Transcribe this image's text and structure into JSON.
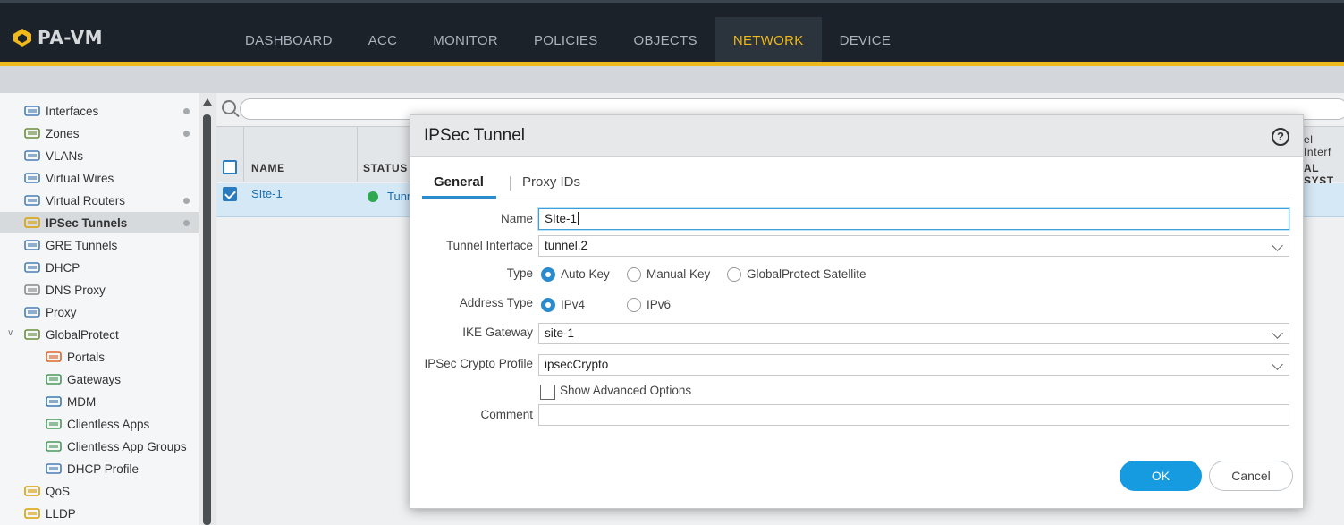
{
  "app": {
    "product": "PA-VM"
  },
  "nav": {
    "items": [
      "DASHBOARD",
      "ACC",
      "MONITOR",
      "POLICIES",
      "OBJECTS",
      "NETWORK",
      "DEVICE"
    ],
    "active": "NETWORK"
  },
  "sidebar": {
    "items": [
      {
        "label": "Interfaces",
        "icon": "interfaces-icon",
        "dot": true
      },
      {
        "label": "Zones",
        "icon": "zones-icon",
        "dot": true
      },
      {
        "label": "VLANs",
        "icon": "vlans-icon",
        "dot": false
      },
      {
        "label": "Virtual Wires",
        "icon": "virtual-wires-icon",
        "dot": false
      },
      {
        "label": "Virtual Routers",
        "icon": "virtual-routers-icon",
        "dot": true
      },
      {
        "label": "IPSec Tunnels",
        "icon": "ipsec-tunnels-icon",
        "dot": true,
        "selected": true
      },
      {
        "label": "GRE Tunnels",
        "icon": "gre-tunnels-icon",
        "dot": false
      },
      {
        "label": "DHCP",
        "icon": "dhcp-icon",
        "dot": false
      },
      {
        "label": "DNS Proxy",
        "icon": "dns-proxy-icon",
        "dot": false
      },
      {
        "label": "Proxy",
        "icon": "proxy-icon",
        "dot": false
      },
      {
        "label": "GlobalProtect",
        "icon": "globalprotect-icon",
        "dot": false,
        "expanded": true
      },
      {
        "label": "Portals",
        "icon": "portals-icon",
        "dot": false,
        "child": true
      },
      {
        "label": "Gateways",
        "icon": "gateways-icon",
        "dot": false,
        "child": true
      },
      {
        "label": "MDM",
        "icon": "mdm-icon",
        "dot": false,
        "child": true
      },
      {
        "label": "Clientless Apps",
        "icon": "clientless-apps-icon",
        "dot": false,
        "child": true
      },
      {
        "label": "Clientless App Groups",
        "icon": "clientless-app-groups-icon",
        "dot": false,
        "child": true
      },
      {
        "label": "DHCP Profile",
        "icon": "dhcp-profile-icon",
        "dot": false,
        "child": true
      },
      {
        "label": "QoS",
        "icon": "qos-icon",
        "dot": false
      },
      {
        "label": "LLDP",
        "icon": "lldp-icon",
        "dot": false
      }
    ]
  },
  "table": {
    "headers": {
      "name": "NAME",
      "status": "STATUS",
      "right_top": "el Interf",
      "right_bottom": "AL SYST"
    },
    "rows": [
      {
        "name": "SIte-1",
        "status": "Tunn"
      }
    ]
  },
  "dialog": {
    "title": "IPSec Tunnel",
    "help": "?",
    "tabs": [
      "General",
      "Proxy IDs"
    ],
    "labels": {
      "name": "Name",
      "tunnel_interface": "Tunnel Interface",
      "type": "Type",
      "address_type": "Address Type",
      "ike_gateway": "IKE Gateway",
      "ipsec_crypto_profile": "IPSec Crypto Profile",
      "comment": "Comment"
    },
    "values": {
      "name": "SIte-1",
      "tunnel_interface": "tunnel.2",
      "ike_gateway": "site-1",
      "ipsec_crypto_profile": "ipsecCrypto",
      "comment": ""
    },
    "type_options": [
      "Auto Key",
      "Manual Key",
      "GlobalProtect Satellite"
    ],
    "type_selected": "Auto Key",
    "address_options": [
      "IPv4",
      "IPv6"
    ],
    "address_selected": "IPv4",
    "show_advanced": "Show Advanced Options",
    "ok": "OK",
    "cancel": "Cancel"
  },
  "colors": {
    "accent": "#f0b81a",
    "primary": "#169ae0",
    "nav_bg": "#1b2229"
  }
}
